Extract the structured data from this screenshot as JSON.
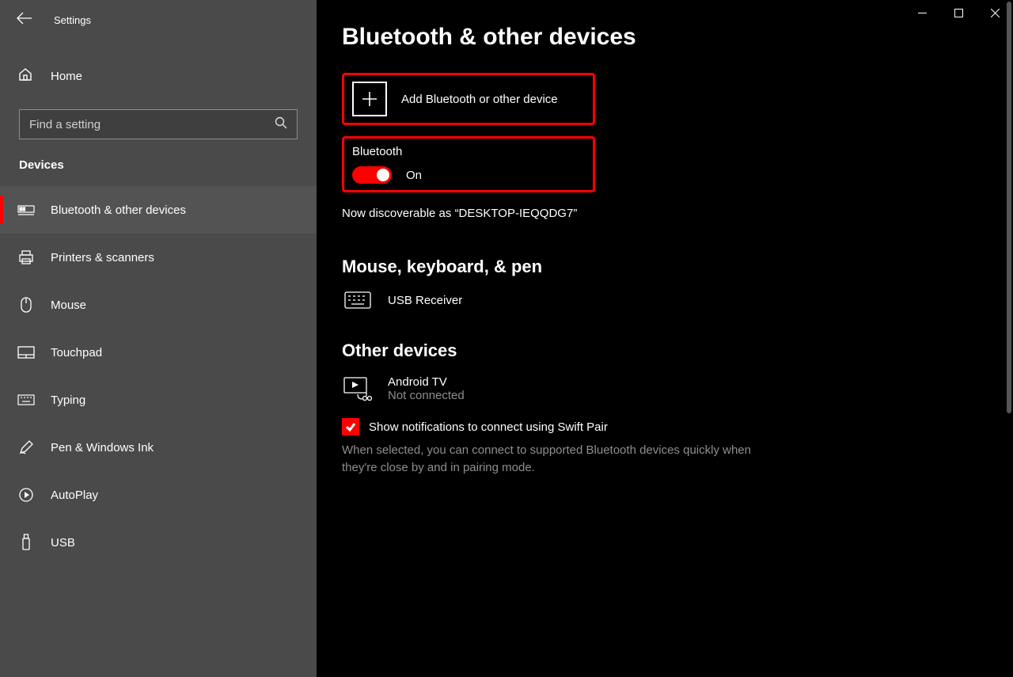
{
  "window": {
    "title": "Settings"
  },
  "sidebar": {
    "home": "Home",
    "search_placeholder": "Find a setting",
    "section": "Devices",
    "items": [
      {
        "label": "Bluetooth & other devices",
        "active": true
      },
      {
        "label": "Printers & scanners"
      },
      {
        "label": "Mouse"
      },
      {
        "label": "Touchpad"
      },
      {
        "label": "Typing"
      },
      {
        "label": "Pen & Windows Ink"
      },
      {
        "label": "AutoPlay"
      },
      {
        "label": "USB"
      }
    ]
  },
  "main": {
    "title": "Bluetooth & other devices",
    "add_device_label": "Add Bluetooth or other device",
    "bluetooth_label": "Bluetooth",
    "bluetooth_state": "On",
    "discoverable_text": "Now discoverable as “DESKTOP-IEQQDG7”",
    "mouse_section": "Mouse, keyboard, & pen",
    "usb_receiver": "USB Receiver",
    "other_section": "Other devices",
    "android_tv": {
      "name": "Android TV",
      "status": "Not connected"
    },
    "swift_pair_label": "Show notifications to connect using Swift Pair",
    "swift_pair_desc": "When selected, you can connect to supported Bluetooth devices quickly when they're close by and in pairing mode."
  }
}
